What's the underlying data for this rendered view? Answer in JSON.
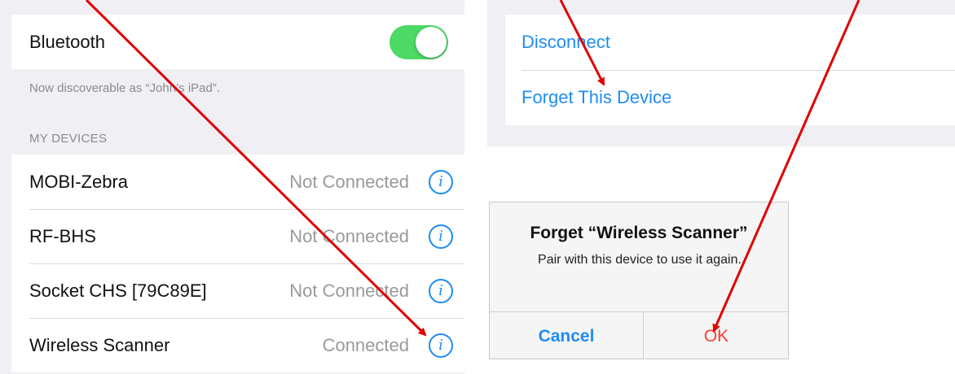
{
  "bluetooth": {
    "label": "Bluetooth",
    "enabled": true,
    "discoverable_text": "Now discoverable as “John’s iPad”.",
    "section_title": "MY DEVICES",
    "devices": [
      {
        "name": "MOBI-Zebra",
        "status": "Not Connected"
      },
      {
        "name": "RF-BHS",
        "status": "Not Connected"
      },
      {
        "name": "Socket CHS [79C89E]",
        "status": "Not Connected"
      },
      {
        "name": "Wireless Scanner",
        "status": "Connected"
      }
    ],
    "info_glyph": "i"
  },
  "device_actions": {
    "disconnect_label": "Disconnect",
    "forget_label": "Forget This Device"
  },
  "alert": {
    "title": "Forget “Wireless Scanner”",
    "message": "Pair with this device to use it again.",
    "cancel_label": "Cancel",
    "ok_label": "OK"
  },
  "colors": {
    "ios_blue": "#1e8cf5",
    "toggle_green": "#4cd964",
    "destructive_red": "#ff3b30",
    "annotation_red": "#e00000",
    "grouped_background": "#efeff4"
  }
}
